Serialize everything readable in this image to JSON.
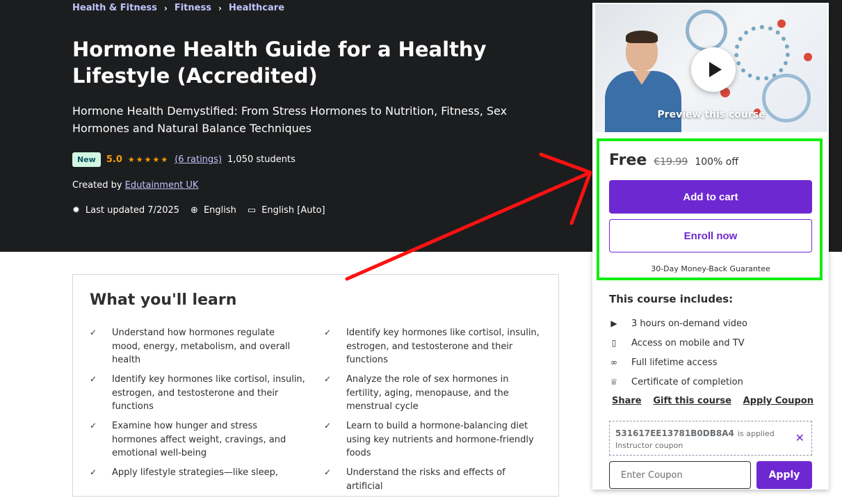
{
  "breadcrumb": [
    "Health & Fitness",
    "Fitness",
    "Healthcare"
  ],
  "course": {
    "title": "Hormone Health Guide for a Healthy Lifestyle (Accredited)",
    "subtitle": "Hormone Health Demystified: From Stress Hormones to Nutrition, Fitness, Sex Hormones and Natural Balance Techniques",
    "badge": "New",
    "rating": "5.0",
    "rating_count": "(6 ratings)",
    "students": "1,050 students",
    "created_by_label": "Created by",
    "instructor": "Edutainment UK",
    "last_updated": "Last updated 7/2025",
    "language": "English",
    "captions": "English [Auto]"
  },
  "learn": {
    "title": "What you'll learn",
    "left": [
      "Understand how hormones regulate mood, energy, metabolism, and overall health",
      "Identify key hormones like cortisol, insulin, estrogen, and testosterone and their functions",
      "Examine how hunger and stress hormones affect weight, cravings, and emotional well-being",
      "Apply lifestyle strategies—like sleep,"
    ],
    "right": [
      "Identify key hormones like cortisol, insulin, estrogen, and testosterone and their functions",
      "Analyze the role of sex hormones in fertility, aging, menopause, and the menstrual cycle",
      "Learn to build a hormone-balancing diet using key nutrients and hormone-friendly foods",
      "Understand the risks and effects of artificial"
    ]
  },
  "sidebar": {
    "preview_label": "Preview this course",
    "price": "Free",
    "original_price": "€19.99",
    "discount": "100% off",
    "add_to_cart": "Add to cart",
    "enroll_now": "Enroll now",
    "guarantee": "30-Day Money-Back Guarantee",
    "includes_title": "This course includes:",
    "includes": [
      {
        "icon": "video-icon",
        "label": "3 hours on-demand video"
      },
      {
        "icon": "mobile-icon",
        "label": "Access on mobile and TV"
      },
      {
        "icon": "infinity-icon",
        "label": "Full lifetime access"
      },
      {
        "icon": "trophy-icon",
        "label": "Certificate of completion"
      }
    ],
    "share": "Share",
    "gift": "Gift this course",
    "apply_coupon": "Apply Coupon",
    "coupon_code": "531617EE13781B0DB8A4",
    "coupon_applied": "is applied",
    "coupon_type": "Instructor coupon",
    "coupon_placeholder": "Enter Coupon",
    "apply": "Apply"
  },
  "colors": {
    "hero_bg": "#1c1d1f",
    "accent_purple": "#6d28d2",
    "star_orange": "#f69c08",
    "link_lavender": "#c0c4fc",
    "highlight_green": "#11ee11",
    "annotation_arrow": "#ff1111"
  }
}
